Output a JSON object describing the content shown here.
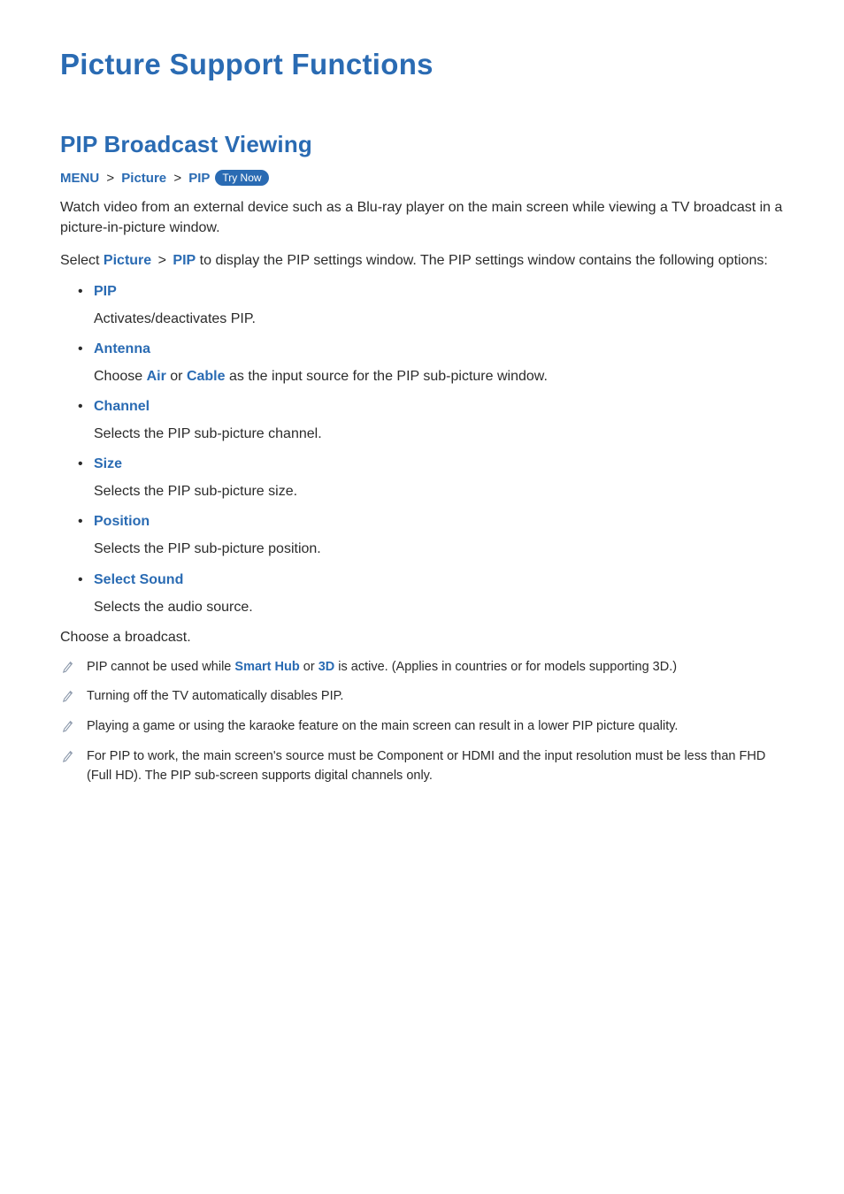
{
  "page_title": "Picture Support Functions",
  "section_title": "PIP Broadcast Viewing",
  "breadcrumb": {
    "items": [
      "MENU",
      "Picture",
      "PIP"
    ],
    "try_now": "Try Now"
  },
  "intro_paragraph": "Watch video from an external device such as a Blu-ray player on the main screen while viewing a TV broadcast in a picture-in-picture window.",
  "select_line": {
    "prefix": "Select ",
    "kw1": "Picture",
    "kw2": "PIP",
    "suffix": " to display the PIP settings window. The PIP settings window contains the following options:"
  },
  "options": [
    {
      "title": "PIP",
      "desc_plain": "Activates/deactivates PIP."
    },
    {
      "title": "Antenna",
      "desc_pre": "Choose ",
      "desc_kw1": "Air",
      "desc_mid": " or ",
      "desc_kw2": "Cable",
      "desc_post": " as the input source for the PIP sub-picture window."
    },
    {
      "title": "Channel",
      "desc_plain": "Selects the PIP sub-picture channel."
    },
    {
      "title": "Size",
      "desc_plain": "Selects the PIP sub-picture size."
    },
    {
      "title": "Position",
      "desc_plain": "Selects the PIP sub-picture position."
    },
    {
      "title": "Select Sound",
      "desc_plain": "Selects the audio source."
    }
  ],
  "after_list": "Choose a broadcast.",
  "notes": [
    {
      "pre": "PIP cannot be used while ",
      "kw1": "Smart Hub",
      "mid": " or ",
      "kw2": "3D",
      "post": " is active. (Applies in countries or for models supporting 3D.)"
    },
    {
      "plain": "Turning off the TV automatically disables PIP."
    },
    {
      "plain": "Playing a game or using the karaoke feature on the main screen can result in a lower PIP picture quality."
    },
    {
      "plain": "For PIP to work, the main screen's source must be Component or HDMI and the input resolution must be less than FHD (Full HD). The PIP sub-screen supports digital channels only."
    }
  ]
}
